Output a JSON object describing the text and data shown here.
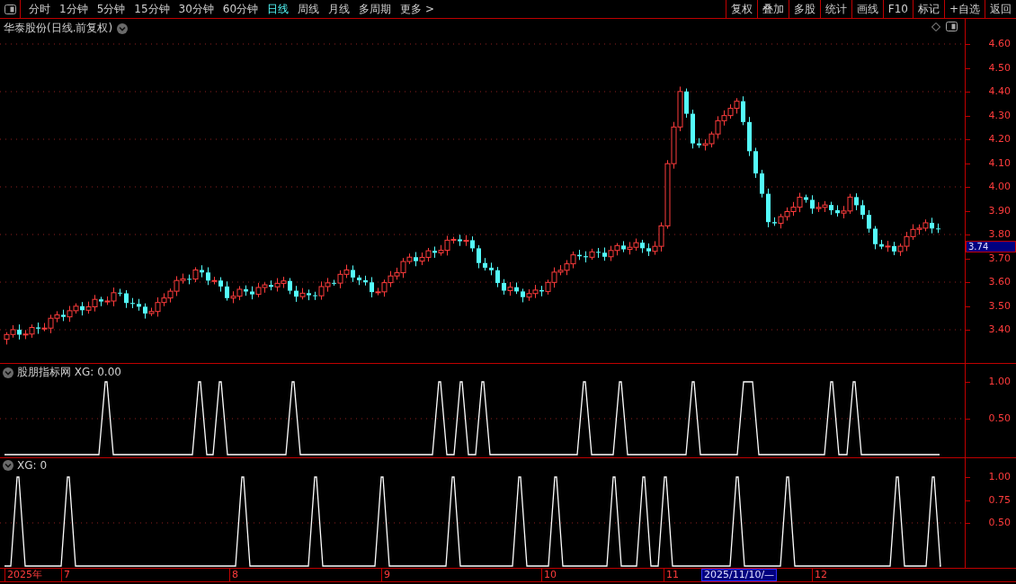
{
  "toolbar": {
    "periods": [
      {
        "label": "分时",
        "selected": false
      },
      {
        "label": "1分钟",
        "selected": false
      },
      {
        "label": "5分钟",
        "selected": false
      },
      {
        "label": "15分钟",
        "selected": false
      },
      {
        "label": "30分钟",
        "selected": false
      },
      {
        "label": "60分钟",
        "selected": false
      },
      {
        "label": "日线",
        "selected": true
      },
      {
        "label": "周线",
        "selected": false
      },
      {
        "label": "月线",
        "selected": false
      },
      {
        "label": "多周期",
        "selected": false
      },
      {
        "label": "更多 >",
        "selected": false
      }
    ],
    "buttons": [
      "复权",
      "叠加",
      "多股",
      "统计",
      "画线",
      "F10",
      "标记",
      "+自选",
      "返回"
    ]
  },
  "main_panel": {
    "title": "华泰股份(日线.前复权)",
    "price_ticks": [
      "4.60",
      "4.50",
      "4.40",
      "4.30",
      "4.20",
      "4.10",
      "4.00",
      "3.90",
      "3.80",
      "3.70",
      "3.60",
      "3.50",
      "3.40"
    ],
    "cursor_price": "3.74"
  },
  "indicator_panels": [
    {
      "title": "股朋指标网 XG: 0.00",
      "ticks": [
        "1.00",
        "0.50"
      ]
    },
    {
      "title": "XG: 0",
      "ticks": [
        "1.00",
        "0.75",
        "0.50"
      ]
    }
  ],
  "date_axis": {
    "labels": [
      "2025年",
      "7",
      "8",
      "9",
      "10",
      "11",
      "12"
    ],
    "cursor_date": "2025/11/10/—"
  }
}
